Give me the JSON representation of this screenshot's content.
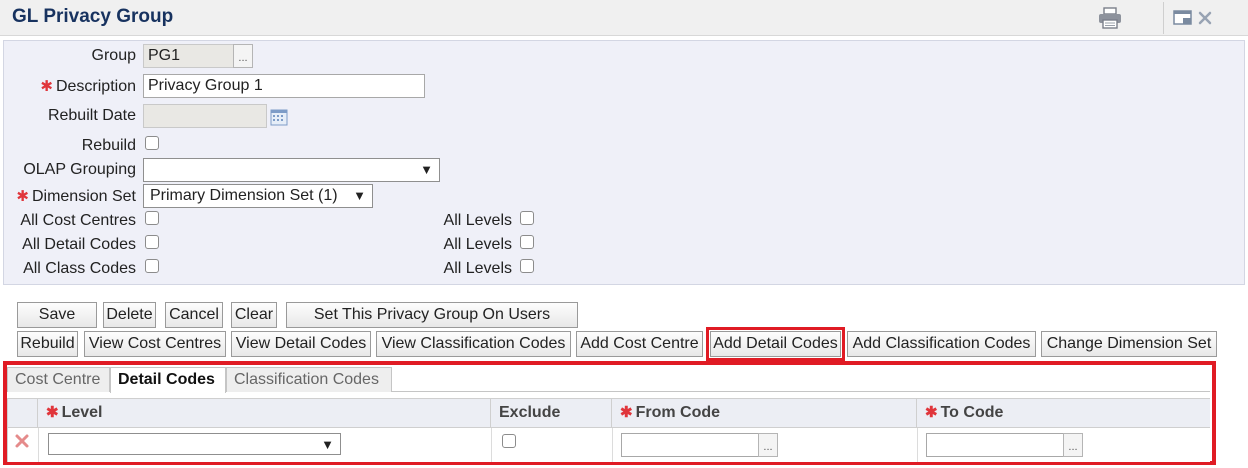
{
  "window": {
    "title": "GL Privacy Group",
    "print_icon": "printer-icon",
    "close_icon": "window-close-icon"
  },
  "form": {
    "group_label": "Group",
    "group_value": "PG1",
    "lookup_label": "...",
    "description_label": "Description",
    "description_value": "Privacy Group 1",
    "rebuilt_date_label": "Rebuilt Date",
    "rebuilt_date_value": "",
    "rebuild_label": "Rebuild",
    "olap_grouping_label": "OLAP Grouping",
    "olap_grouping_value": "",
    "dimension_set_label": "Dimension Set",
    "dimension_set_value": "Primary Dimension Set (1)",
    "all_cost_centres_label": "All Cost Centres",
    "all_detail_codes_label": "All Detail Codes",
    "all_class_codes_label": "All Class Codes",
    "all_levels_label": "All Levels",
    "required_marker": "✱"
  },
  "toolbar_row1": [
    "Save",
    "Delete",
    "Cancel",
    "Clear",
    "Set This Privacy Group On Users"
  ],
  "toolbar_row2": [
    "Rebuild",
    "View Cost Centres",
    "View Detail Codes",
    "View Classification Codes",
    "Add Cost Centre",
    "Add Detail Codes",
    "Add Classification Codes",
    "Change Dimension Set"
  ],
  "tabs": [
    "Cost Centre",
    "Detail Codes",
    "Classification Codes"
  ],
  "active_tab": "Detail Codes",
  "grid": {
    "columns": [
      "Level",
      "Exclude",
      "From Code",
      "To Code"
    ],
    "row": {
      "level": "",
      "exclude": false,
      "from_code": "",
      "to_code": ""
    }
  },
  "colors": {
    "title": "#17325f",
    "highlight": "#e01b24",
    "required": "#e0353b",
    "panel": "#eff0f8"
  }
}
